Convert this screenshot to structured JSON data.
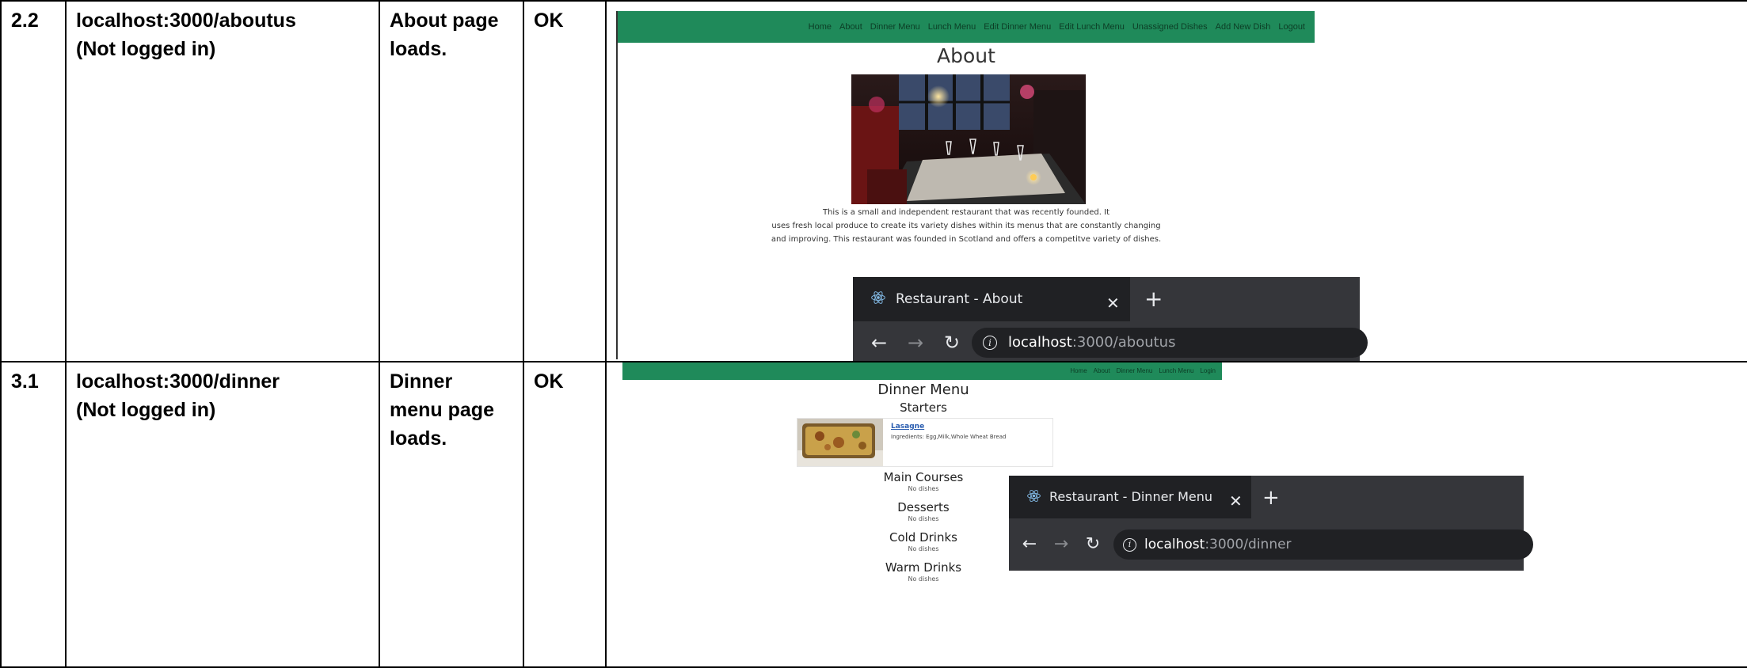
{
  "rows": [
    {
      "id": "2.2",
      "test_line1": "localhost:3000/aboutus",
      "test_line2": "(Not logged in)",
      "expected_line1": "About page",
      "expected_line2": "loads.",
      "result": "OK",
      "screenshot": {
        "nav_items": [
          "Home",
          "About",
          "Dinner Menu",
          "Lunch Menu",
          "Edit Dinner Menu",
          "Edit Lunch Menu",
          "Unassigned Dishes",
          "Add New Dish",
          "Logout"
        ],
        "page_title": "About",
        "description_lines": [
          "This is a small and independent restaurant that was recently founded. It",
          "uses fresh local produce to create its variety dishes within its menus that are constantly changing",
          "and improving. This restaurant was founded in Scotland and offers a competitve variety of dishes."
        ],
        "browser": {
          "tab_title": "Restaurant - About",
          "url_host": "localhost",
          "url_rest": ":3000/aboutus"
        }
      }
    },
    {
      "id": "3.1",
      "test_line1": "localhost:3000/dinner",
      "test_line2": "(Not logged in)",
      "expected_line1": "Dinner",
      "expected_line2": "menu page",
      "expected_line3": "loads.",
      "result": "OK",
      "screenshot": {
        "nav_items": [
          "Home",
          "About",
          "Dinner Menu",
          "Lunch Menu",
          "Login"
        ],
        "page_title": "Dinner Menu",
        "sections": [
          {
            "title": "Starters"
          },
          {
            "title": "Main Courses",
            "empty": "No dishes"
          },
          {
            "title": "Desserts",
            "empty": "No dishes"
          },
          {
            "title": "Cold Drinks",
            "empty": "No dishes"
          },
          {
            "title": "Warm Drinks",
            "empty": "No dishes"
          }
        ],
        "dish": {
          "name": "Lasagne",
          "ingredients": "Ingredients: Egg,Milk,Whole Wheat Bread"
        },
        "browser": {
          "tab_title": "Restaurant - Dinner Menu",
          "url_host": "localhost",
          "url_rest": ":3000/dinner"
        }
      }
    }
  ],
  "colors": {
    "navbar": "#1f8a5a",
    "browser_chrome": "#35363a",
    "browser_tab": "#202124",
    "react_logo": "#7fb5e0"
  }
}
